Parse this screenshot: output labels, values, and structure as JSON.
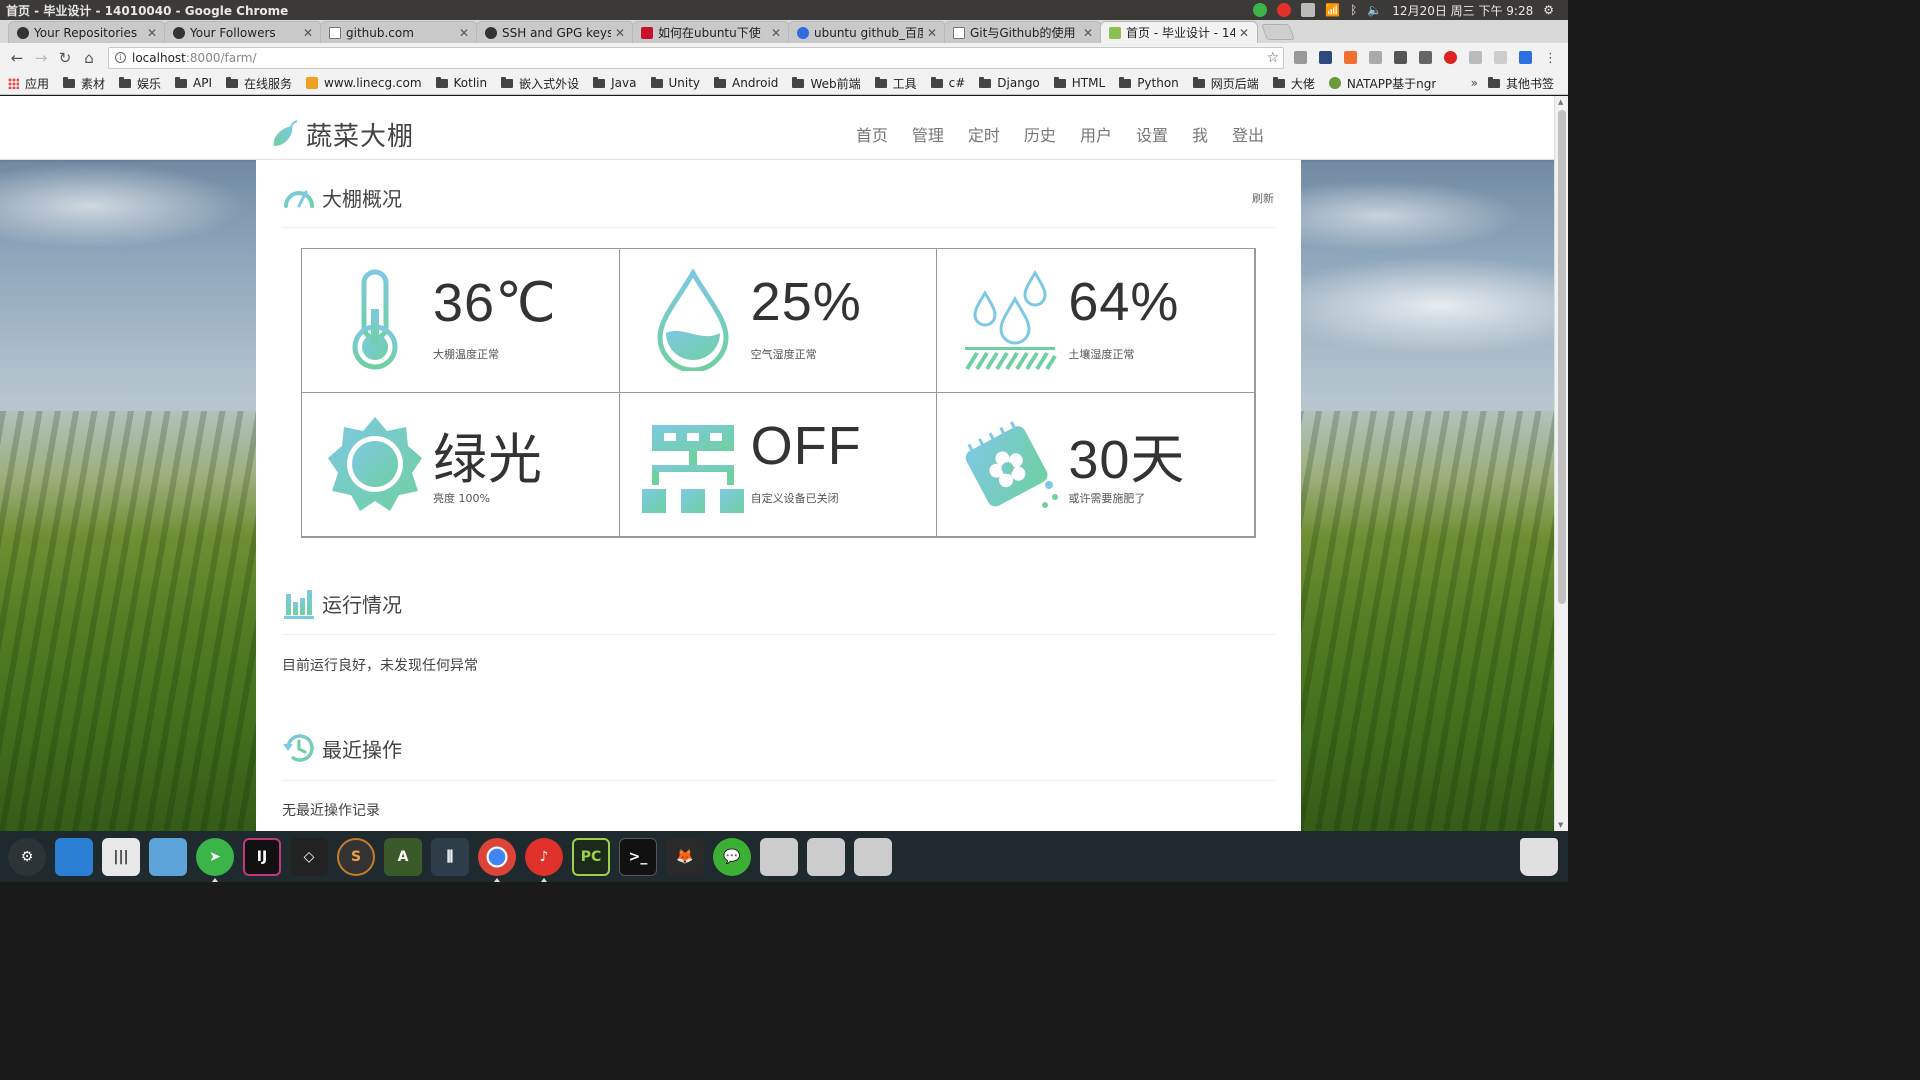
{
  "os": {
    "window_title": "首页 - 毕业设计 - 14010040 - Google Chrome",
    "clock": "12月20日 周三 下午 9:28"
  },
  "tabs": [
    {
      "label": "Your Repositories",
      "icon": "github-icon"
    },
    {
      "label": "Your Followers",
      "icon": "github-icon"
    },
    {
      "label": "github.com",
      "icon": "page-icon"
    },
    {
      "label": "SSH and GPG keys",
      "icon": "github-icon"
    },
    {
      "label": "如何在ubuntu下使",
      "icon": "csdn-icon"
    },
    {
      "label": "ubuntu github_百度",
      "icon": "baidu-icon"
    },
    {
      "label": "Git与Github的使用",
      "icon": "page-icon"
    },
    {
      "label": "首页 - 毕业设计 - 14",
      "icon": "site-icon",
      "active": true
    }
  ],
  "toolbar": {
    "url_host": "localhost",
    "url_path": ":8000/farm/"
  },
  "bookmarks": [
    "应用",
    "素材",
    "娱乐",
    "API",
    "在线服务",
    "www.linecg.com",
    "Kotlin",
    "嵌入式外设",
    "Java",
    "Unity",
    "Android",
    "Web前端",
    "工具",
    "c#",
    "Django",
    "HTML",
    "Python",
    "网页后端",
    "大佬",
    "NATAPP基于ngr"
  ],
  "bookmarks_more": "»",
  "bookmarks_other": "其他书签",
  "site": {
    "brand": "蔬菜大棚",
    "nav": [
      "首页",
      "管理",
      "定时",
      "历史",
      "用户",
      "设置",
      "我",
      "登出"
    ]
  },
  "overview": {
    "title": "大棚概况",
    "refresh": "刷新",
    "cards": [
      {
        "icon": "thermometer-icon",
        "value": "36℃",
        "desc": "大棚温度正常"
      },
      {
        "icon": "water-drop-icon",
        "value": "25%",
        "desc": "空气湿度正常"
      },
      {
        "icon": "soil-moisture-icon",
        "value": "64%",
        "desc": "土壤湿度正常"
      },
      {
        "icon": "sun-icon",
        "value": "绿光",
        "desc": "亮度 100%"
      },
      {
        "icon": "device-network-icon",
        "value": "OFF",
        "desc": "自定义设备已关闭"
      },
      {
        "icon": "fertilizer-bag-icon",
        "value": "30天",
        "desc": "或许需要施肥了"
      }
    ]
  },
  "status": {
    "title": "运行情况",
    "text": "目前运行良好，未发现任何异常"
  },
  "recent": {
    "title": "最近操作",
    "text": "无最近操作记录"
  },
  "colors": {
    "accent_start": "#7ec8e3",
    "accent_end": "#6fd0a0"
  }
}
